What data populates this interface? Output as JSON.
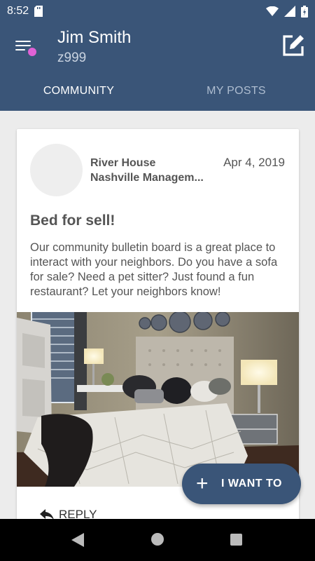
{
  "status_bar": {
    "time": "8:52"
  },
  "header": {
    "user_name": "Jim Smith",
    "user_id": "z999"
  },
  "tabs": [
    {
      "label": "COMMUNITY",
      "active": true
    },
    {
      "label": "MY POSTS",
      "active": false
    }
  ],
  "post": {
    "author_line1": "River House",
    "author_line2": "Nashville Managem...",
    "date": "Apr 4, 2019",
    "title": "Bed for sell!",
    "body": "Our community bulletin board is a great place to interact with your neighbors.  Do you have a sofa for sale?  Need a pet sitter?  Just found a fun restaurant?  Let your neighbors know!",
    "reply_label": "REPLY"
  },
  "fab": {
    "label": "I WANT TO"
  },
  "colors": {
    "primary": "#3a5578",
    "menu_badge": "#e062d6"
  }
}
